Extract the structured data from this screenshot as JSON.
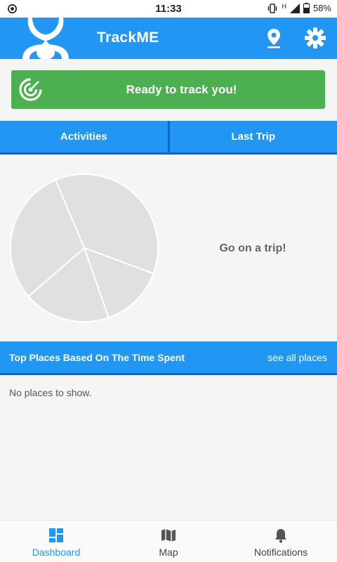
{
  "status_bar": {
    "time": "11:33",
    "network": "H",
    "battery": "58%"
  },
  "app_bar": {
    "title": "TrackME",
    "icons": [
      "location-pin-icon",
      "settings-gear-icon"
    ]
  },
  "track_banner": {
    "label": "Ready to track you!",
    "icon": "radar-icon",
    "color": "#4caf50"
  },
  "tabs": [
    {
      "label": "Activities"
    },
    {
      "label": "Last Trip"
    }
  ],
  "activity_chart": {
    "type": "pie",
    "empty_message": "Go on a trip!",
    "placeholder_slices": [
      0.37,
      0.14,
      0.19,
      0.3
    ]
  },
  "places": {
    "header_title": "Top Places Based On The Time Spent",
    "see_all_label": "see all places",
    "empty_message": "No places to show."
  },
  "bottom_nav": {
    "items": [
      {
        "label": "Dashboard",
        "icon": "dashboard-icon",
        "active": true
      },
      {
        "label": "Map",
        "icon": "map-icon",
        "active": false
      },
      {
        "label": "Notifications",
        "icon": "bell-icon",
        "active": false
      }
    ]
  },
  "colors": {
    "primary": "#2196f3",
    "primary_dark": "#1565c0",
    "success": "#4caf50",
    "pie_placeholder": "#e0e0e0"
  }
}
